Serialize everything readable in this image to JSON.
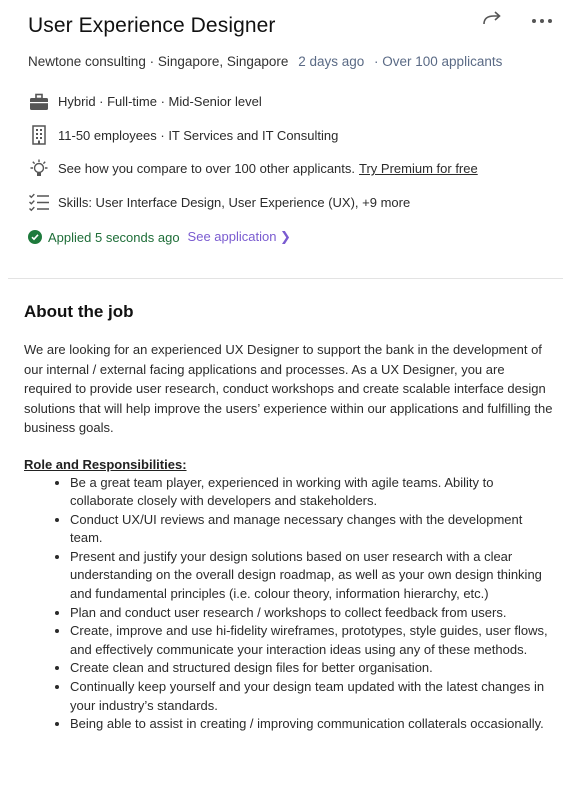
{
  "job": {
    "title": "User Experience Designer",
    "company_location": "Newtone consulting · Singapore, Singapore",
    "posted": "2 days ago",
    "applicants": "· Over 100 applicants",
    "workplace": "Hybrid · Full-time · Mid-Senior level",
    "company_size": "11-50 employees · IT Services and IT Consulting",
    "compare_text": "See how you compare to over 100 other applicants.",
    "premium_link": "Try Premium for free",
    "skills": "Skills: User Interface Design, User Experience (UX), +9 more",
    "applied_status": "Applied 5 seconds ago",
    "see_application": "See application ❯"
  },
  "icons": {
    "share": "share-arrow-icon",
    "more": "more-dots-icon",
    "briefcase": "briefcase-icon",
    "building": "building-icon",
    "lightbulb": "lightbulb-icon",
    "checklist": "checklist-icon",
    "check": "check-circle-icon"
  },
  "colors": {
    "applied_green": "#1e7a3c",
    "link_purple": "#7a5bd0",
    "muted_blue": "#5a6a85"
  },
  "about": {
    "heading": "About the job",
    "intro": "We are looking for an experienced UX Designer to support the bank in the development of our internal / external facing applications and processes. As a UX Designer, you are required to provide user research, conduct workshops and create scalable interface design solutions that will help improve the users’ experience within our applications and fulfilling the business goals.",
    "roles_heading": "Role and Responsibilities:",
    "responsibilities": [
      "Be a great team player, experienced in working with agile teams. Ability to collaborate closely with developers and stakeholders.",
      "Conduct UX/UI reviews and manage necessary changes with the development team.",
      "Present and justify your design solutions based on user research with a clear understanding on the overall design roadmap, as well as your own design thinking and fundamental principles (i.e. colour theory, information hierarchy, etc.)",
      "Plan and conduct user research / workshops to collect feedback from users.",
      "Create, improve and use hi-fidelity wireframes, prototypes, style guides, user flows, and effectively communicate your interaction ideas using any of these methods.",
      "Create clean and structured design files for better organisation.",
      "Continually keep yourself and your design team updated with the latest changes in your industry’s standards.",
      "Being able to assist in creating / improving communication collaterals occasionally."
    ]
  }
}
